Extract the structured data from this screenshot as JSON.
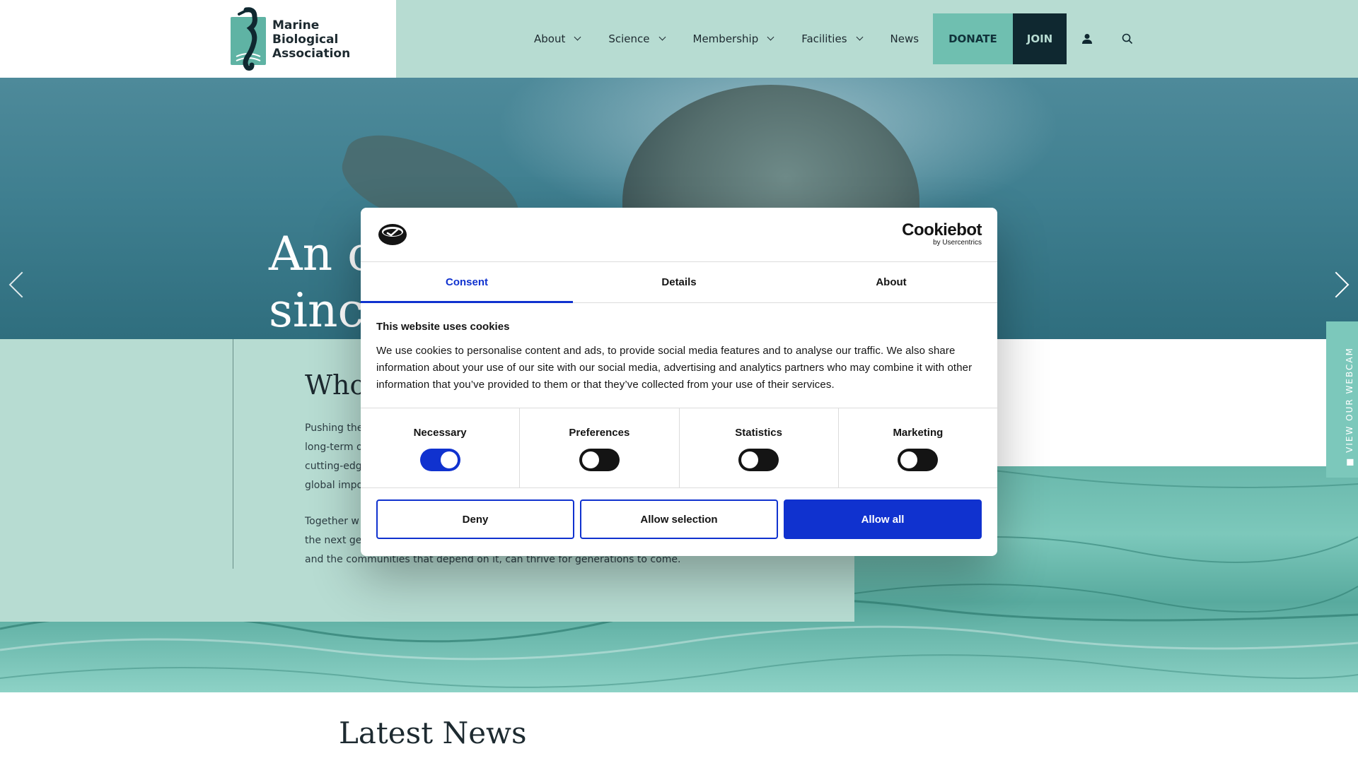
{
  "brand": {
    "logo_lines": [
      "Marine",
      "Biological",
      "Association"
    ]
  },
  "nav": {
    "items": [
      {
        "label": "About",
        "has_dropdown": true
      },
      {
        "label": "Science",
        "has_dropdown": true
      },
      {
        "label": "Membership",
        "has_dropdown": true
      },
      {
        "label": "Facilities",
        "has_dropdown": true
      },
      {
        "label": "News",
        "has_dropdown": false
      }
    ],
    "donate_label": "DONATE",
    "join_label": "JOIN",
    "account_icon": "user-icon",
    "search_icon": "search-icon"
  },
  "hero": {
    "title_line1": "An o",
    "title_line2": "since"
  },
  "who": {
    "title": "Who",
    "para1_lines": [
      "Pushing the",
      "long-term o",
      "cutting-edg",
      "global impo"
    ],
    "para2_lines": [
      "Together w",
      "the next ge",
      "and the communities that depend on it, can thrive for generations to come."
    ]
  },
  "webcam": {
    "label": "VIEW OUR WEBCAM"
  },
  "news": {
    "title": "Latest News"
  },
  "cookie_dialog": {
    "brand_name": "Cookiebot",
    "brand_sub": "by Usercentrics",
    "tabs": [
      {
        "label": "Consent",
        "active": true
      },
      {
        "label": "Details",
        "active": false
      },
      {
        "label": "About",
        "active": false
      }
    ],
    "heading": "This website uses cookies",
    "body": "We use cookies to personalise content and ads, to provide social media features and to analyse our traffic. We also share information about your use of our site with our social media, advertising and analytics partners who may combine it with other information that you’ve provided to them or that they’ve collected from your use of their services.",
    "categories": [
      {
        "label": "Necessary",
        "checked": true
      },
      {
        "label": "Preferences",
        "checked": false
      },
      {
        "label": "Statistics",
        "checked": false
      },
      {
        "label": "Marketing",
        "checked": false
      }
    ],
    "buttons": {
      "deny": "Deny",
      "allow_selection": "Allow selection",
      "allow_all": "Allow all"
    }
  },
  "colors": {
    "header_bg": "#b7dcd2",
    "donate_bg": "#6fbfb0",
    "join_bg": "#0f2830",
    "cookie_accent": "#1032cf"
  }
}
